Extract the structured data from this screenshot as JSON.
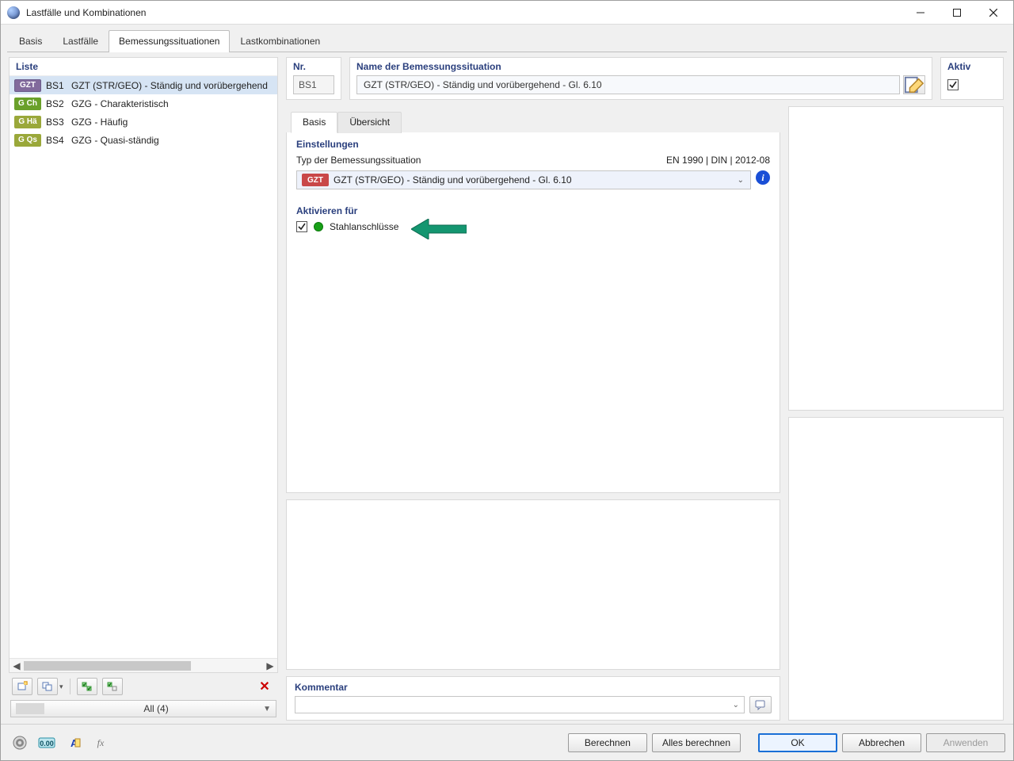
{
  "window": {
    "title": "Lastfälle und Kombinationen"
  },
  "tabs": {
    "basis": "Basis",
    "lastfaelle": "Lastfälle",
    "bemessung": "Bemessungssituationen",
    "lastkomb": "Lastkombinationen"
  },
  "liste": {
    "header": "Liste",
    "rows": [
      {
        "badge": "GZT",
        "cls": "b-purple",
        "num": "BS1",
        "name": "GZT (STR/GEO) - Ständig und vorübergehend"
      },
      {
        "badge": "G Ch",
        "cls": "b-green",
        "num": "BS2",
        "name": "GZG - Charakteristisch"
      },
      {
        "badge": "G Hä",
        "cls": "b-olive",
        "num": "BS3",
        "name": "GZG - Häufig"
      },
      {
        "badge": "G Qs",
        "cls": "b-olive",
        "num": "BS4",
        "name": "GZG - Quasi-ständig"
      }
    ],
    "filter": "All (4)"
  },
  "detail": {
    "nr_label": "Nr.",
    "nr_value": "BS1",
    "name_label": "Name der Bemessungssituation",
    "name_value": "GZT (STR/GEO) - Ständig und vorübergehend - Gl. 6.10",
    "aktiv_label": "Aktiv"
  },
  "subtabs": {
    "basis": "Basis",
    "uebersicht": "Übersicht"
  },
  "settings": {
    "title": "Einstellungen",
    "type_label": "Typ der Bemessungssituation",
    "norm_text": "EN 1990 | DIN | 2012-08",
    "combo_badge": "GZT",
    "combo_text": "GZT (STR/GEO) - Ständig und vorübergehend - Gl. 6.10"
  },
  "activate": {
    "title": "Aktivieren für",
    "item": "Stahlanschlüsse"
  },
  "kommentar": {
    "title": "Kommentar"
  },
  "footer": {
    "berechnen": "Berechnen",
    "alles": "Alles berechnen",
    "ok": "OK",
    "abbrechen": "Abbrechen",
    "anwenden": "Anwenden"
  }
}
